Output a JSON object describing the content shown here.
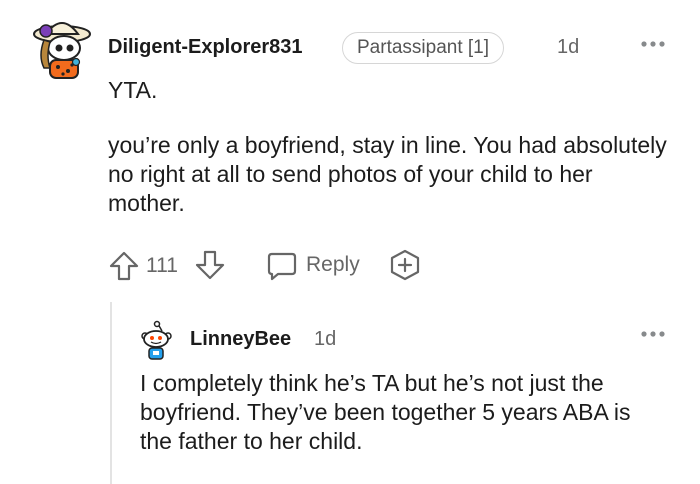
{
  "comment": {
    "username": "Diligent-Explorer831",
    "flair": "Partassipant [1]",
    "time": "1d",
    "more_icon": "more-dots-icon",
    "paragraphs": [
      "YTA.",
      "you’re only a boyfriend, stay in line. You had absolutely no right at all to send photos of your child to her mother."
    ],
    "votes": "111",
    "reply_label": "Reply",
    "icons": {
      "upvote": "arrow-up-icon",
      "downvote": "arrow-down-icon",
      "reply": "comment-bubble-icon",
      "award": "add-award-icon"
    }
  },
  "reply": {
    "username": "LinneyBee",
    "time": "1d",
    "text": "I completely think he’s TA but he’s not just the boyfriend. They’ve been together 5 years ABA is the father to her child."
  }
}
